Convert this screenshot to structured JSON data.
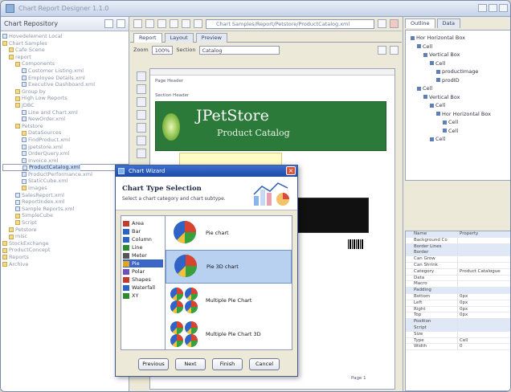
{
  "app": {
    "title": "Chart Report Designer 1.1.0"
  },
  "repository": {
    "header": "Chart Repository",
    "tree": [
      {
        "label": "Hovedelement Local",
        "depth": 0,
        "folder": false
      },
      {
        "label": "Chart Samples",
        "depth": 0,
        "folder": true
      },
      {
        "label": "Cafe Scene",
        "depth": 1,
        "folder": true
      },
      {
        "label": "report",
        "depth": 1,
        "folder": true
      },
      {
        "label": "Components",
        "depth": 2,
        "folder": true
      },
      {
        "label": "Customer Listing.xml",
        "depth": 3,
        "folder": false
      },
      {
        "label": "Employee Details.xml",
        "depth": 3,
        "folder": false
      },
      {
        "label": "Executive Dashboard.xml",
        "depth": 3,
        "folder": false
      },
      {
        "label": "Group by",
        "depth": 2,
        "folder": true
      },
      {
        "label": "High Low Reports",
        "depth": 2,
        "folder": true
      },
      {
        "label": "JDBC",
        "depth": 2,
        "folder": true
      },
      {
        "label": "Line and Chart.xml",
        "depth": 3,
        "folder": false
      },
      {
        "label": "NewOrder.xml",
        "depth": 3,
        "folder": false
      },
      {
        "label": "Petstore",
        "depth": 2,
        "folder": true
      },
      {
        "label": "DataSources",
        "depth": 3,
        "folder": true
      },
      {
        "label": "FindProduct.xml",
        "depth": 3,
        "folder": false
      },
      {
        "label": "jpetstore.xml",
        "depth": 3,
        "folder": false
      },
      {
        "label": "OrderQuery.xml",
        "depth": 3,
        "folder": false
      },
      {
        "label": "Invoice.xml",
        "depth": 3,
        "folder": false
      },
      {
        "label": "ProductCatalog.xml",
        "depth": 3,
        "folder": false,
        "selected": true
      },
      {
        "label": "ProductPerformance.xml",
        "depth": 3,
        "folder": false
      },
      {
        "label": "StaticCube.xml",
        "depth": 3,
        "folder": false
      },
      {
        "label": "images",
        "depth": 3,
        "folder": true
      },
      {
        "label": "SalesReport.xml",
        "depth": 2,
        "folder": false
      },
      {
        "label": "ReportIndex.xml",
        "depth": 2,
        "folder": false
      },
      {
        "label": "Sample Reports.xml",
        "depth": 2,
        "folder": false
      },
      {
        "label": "SimpleCube",
        "depth": 2,
        "folder": true
      },
      {
        "label": "Script",
        "depth": 2,
        "folder": true
      },
      {
        "label": "Petstore",
        "depth": 1,
        "folder": true
      },
      {
        "label": "misc",
        "depth": 1,
        "folder": true
      },
      {
        "label": "StockExchange",
        "depth": 0,
        "folder": true
      },
      {
        "label": "ProductConcept",
        "depth": 0,
        "folder": true
      },
      {
        "label": "Reports",
        "depth": 0,
        "folder": true
      },
      {
        "label": "Archive",
        "depth": 0,
        "folder": true
      }
    ]
  },
  "editor": {
    "path": "Chart Samples/Report/Petstore/ProductCatalog.xml",
    "tabs": [
      "Report",
      "Layout",
      "Preview"
    ],
    "zoom_label": "Zoom",
    "zoom_value": "100%",
    "section_label": "Section",
    "section_value": "Catalog",
    "canvas": {
      "logo": "JPetStore",
      "subtitle": "Product Catalog",
      "label_1": "Page Header",
      "label_2": "Section Header",
      "page_label": "Page 1"
    }
  },
  "outline": {
    "tabs": [
      "Outline",
      "Data"
    ],
    "items": [
      {
        "label": "Hor Horizontal Box",
        "depth": 0
      },
      {
        "label": "Cell",
        "depth": 1
      },
      {
        "label": "Vertical Box",
        "depth": 2
      },
      {
        "label": "Cell",
        "depth": 3
      },
      {
        "label": "productImage",
        "depth": 4
      },
      {
        "label": "prodID",
        "depth": 4
      },
      {
        "label": "Cell",
        "depth": 1
      },
      {
        "label": "Vertical Box",
        "depth": 2
      },
      {
        "label": "Cell",
        "depth": 3
      },
      {
        "label": "Hor Horizontal Box",
        "depth": 4
      },
      {
        "label": "Cell",
        "depth": 5
      },
      {
        "label": "Cell",
        "depth": 5
      },
      {
        "label": "Cell",
        "depth": 3
      }
    ]
  },
  "properties": {
    "headers": [
      "Name",
      "Property"
    ],
    "rows": [
      {
        "name": "Background Co",
        "value": "",
        "cat": false
      },
      {
        "name": "Border Lines",
        "value": "",
        "cat": true
      },
      {
        "name": "Border",
        "value": "",
        "cat": true
      },
      {
        "name": "Can Grow",
        "value": "",
        "cat": false
      },
      {
        "name": "Can Shrink",
        "value": "",
        "cat": false
      },
      {
        "name": "Category",
        "value": "Product Catalogue",
        "cat": false
      },
      {
        "name": "Data",
        "value": "",
        "cat": false
      },
      {
        "name": "Macro",
        "value": "",
        "cat": false
      },
      {
        "name": "Padding",
        "value": "",
        "cat": true
      },
      {
        "name": "Bottom",
        "value": "0px",
        "cat": false
      },
      {
        "name": "Left",
        "value": "0px",
        "cat": false
      },
      {
        "name": "Right",
        "value": "0px",
        "cat": false
      },
      {
        "name": "Top",
        "value": "0px",
        "cat": false
      },
      {
        "name": "Position",
        "value": "",
        "cat": true
      },
      {
        "name": "Script",
        "value": "",
        "cat": true
      },
      {
        "name": "Size",
        "value": "",
        "cat": false
      },
      {
        "name": "Type",
        "value": "Cell",
        "cat": false
      },
      {
        "name": "Width",
        "value": "0",
        "cat": false
      }
    ]
  },
  "dialog": {
    "title": "Chart Wizard",
    "heading": "Chart Type Selection",
    "subheading": "Select a chart category and chart subtype.",
    "categories": [
      {
        "label": "Area",
        "color": "#c23b2d"
      },
      {
        "label": "Bar",
        "color": "#2c63c7"
      },
      {
        "label": "Column",
        "color": "#2c63c7"
      },
      {
        "label": "Line",
        "color": "#2d8a2d"
      },
      {
        "label": "Meter",
        "color": "#555555"
      },
      {
        "label": "Pie",
        "color": "#e2a624",
        "selected": true
      },
      {
        "label": "Polar",
        "color": "#6d4fbf"
      },
      {
        "label": "Shapes",
        "color": "#c23b2d"
      },
      {
        "label": "Waterfall",
        "color": "#2c63c7"
      },
      {
        "label": "XY",
        "color": "#2d8a2d"
      }
    ],
    "subtypes": [
      {
        "label": "Pie chart",
        "selected": false
      },
      {
        "label": "Pie 3D chart",
        "selected": true
      },
      {
        "label": "Multiple Pie Chart",
        "selected": false
      },
      {
        "label": "Multiple Pie Chart 3D",
        "selected": false
      }
    ],
    "buttons": [
      "Previous",
      "Next",
      "Finish",
      "Cancel"
    ]
  }
}
